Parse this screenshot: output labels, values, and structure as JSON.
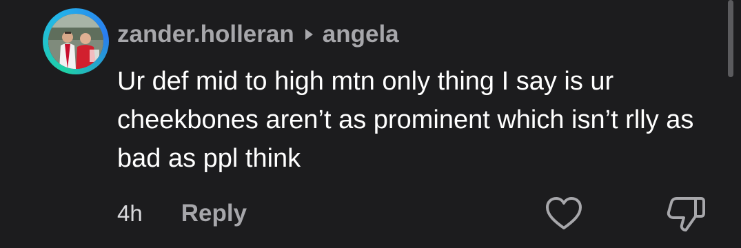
{
  "comment": {
    "username": "zander.holleran",
    "reply_to": "angela",
    "text": "Ur def mid to high mtn only thing I say is ur cheekbones aren’t as prominent which isn’t rlly as bad as ppl think",
    "time": "4h",
    "reply_label": "Reply"
  },
  "icons": {
    "avatar": "user-avatar-photo",
    "reply_arrow": "play-arrow-icon",
    "like": "heart-outline-icon",
    "dislike": "thumbs-down-outline-icon"
  },
  "colors": {
    "background": "#1c1c1e",
    "username": "#a7a7ab",
    "text": "#ffffff",
    "ring_gradient": [
      "#1fd1a5",
      "#23b6e8",
      "#2a7cf0"
    ]
  }
}
